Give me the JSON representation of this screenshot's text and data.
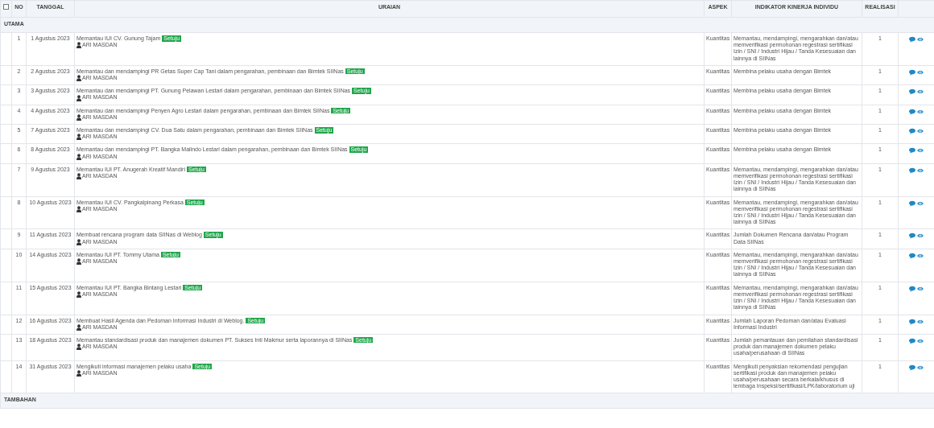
{
  "table": {
    "select_all": {
      "checked": false
    },
    "columns": [
      "NO",
      "TANGGAL",
      "URAIAN",
      "ASPEK",
      "INDIKATOR KINERJA INDIVIDU",
      "REALISASI"
    ],
    "sections": [
      {
        "title": "UTAMA",
        "rows": [
          {
            "no": "1",
            "date": "1 Agustus 2023",
            "uraian": "Memantau IUI CV. Gunung Tajam",
            "status": "Setuju",
            "person": "ARI MASDAN",
            "aspek": "Kuantitas",
            "indikator": "Memantau, mendampingi, mengarahkan dan/atau memverifikasi permohonan regestrasi sertifikasi Izin / SNI / Industri Hijau / Tanda Kesesuaian dan lainnya di SIINas",
            "realisasi": "1"
          },
          {
            "no": "2",
            "date": "2 Agustus 2023",
            "uraian": "Memantau dan mendampingi PR Getas Super Cap Tani dalam pengarahan, pembinaan dan Bimtek SIINas",
            "status": "Setuju",
            "person": "ARI MASDAN",
            "aspek": "Kuantitas",
            "indikator": "Membina pelaku usaha dengan Bimtek",
            "realisasi": "1"
          },
          {
            "no": "3",
            "date": "3 Agustus 2023",
            "uraian": "Memantau dan mendampingi PT. Gunung Pelawan Lestari dalam pengarahan, pembinaan dan Bimtek SIINas",
            "status": "Setuju",
            "person": "ARI MASDAN",
            "aspek": "Kuantitas",
            "indikator": "Membina pelaku usaha dengan Bimtek",
            "realisasi": "1"
          },
          {
            "no": "4",
            "date": "4 Agustus 2023",
            "uraian": "Memantau dan mendampingi Penyen Agro Lestari dalam pengarahan, pembinaan dan Bimtek SIINas",
            "status": "Setuju",
            "person": "ARI MASDAN",
            "aspek": "Kuantitas",
            "indikator": "Membina pelaku usaha dengan Bimtek",
            "realisasi": "1"
          },
          {
            "no": "5",
            "date": "7 Agustus 2023",
            "uraian": "Memantau dan mendampingi CV. Dua Satu dalam pengarahan, pembinaan dan Bimtek SIINas",
            "status": "Setuju",
            "person": "ARI MASDAN",
            "aspek": "Kuantitas",
            "indikator": "Membina pelaku usaha dengan Bimtek",
            "realisasi": "1"
          },
          {
            "no": "6",
            "date": "8 Agustus 2023",
            "uraian": "Memantau dan mendampingi PT. Bangka Malindo Lestari dalam pengarahan, pembinaan dan Bimtek SIINas",
            "status": "Setuju",
            "person": "ARI MASDAN",
            "aspek": "Kuantitas",
            "indikator": "Membina pelaku usaha dengan Bimtek",
            "realisasi": "1"
          },
          {
            "no": "7",
            "date": "9 Agustus 2023",
            "uraian": "Memantau IUI PT. Anugerah Kreatif Mandiri",
            "status": "Setuju",
            "person": "ARI MASDAN",
            "aspek": "Kuantitas",
            "indikator": "Memantau, mendampingi, mengarahkan dan/atau memverifikasi permohonan regestrasi sertifikasi Izin / SNI / Industri Hijau / Tanda Kesesuaian dan lainnya di SIINas",
            "realisasi": "1"
          },
          {
            "no": "8",
            "date": "10 Agustus 2023",
            "uraian": "Memantau IUI CV. Pangkalpinang Perkasa",
            "status": "Setuju",
            "person": "ARI MASDAN",
            "aspek": "Kuantitas",
            "indikator": "Memantau, mendampingi, mengarahkan dan/atau memverifikasi permohonan regestrasi sertifikasi Izin / SNI / Industri Hijau / Tanda Kesesuaian dan lainnya di SIINas",
            "realisasi": "1"
          },
          {
            "no": "9",
            "date": "11 Agustus 2023",
            "uraian": "Membuat rencana program data SIINas di Weblog",
            "status": "Setuju",
            "person": "ARI MASDAN",
            "aspek": "Kuantitas",
            "indikator": "Jumlah Dokumen Rencana dan/atau Program Data SIINas",
            "realisasi": "1"
          },
          {
            "no": "10",
            "date": "14 Agustus 2023",
            "uraian": "Memantau IUI PT. Tommy Utama",
            "status": "Setuju",
            "person": "ARI MASDAN",
            "aspek": "Kuantitas",
            "indikator": "Memantau, mendampingi, mengarahkan dan/atau memverifikasi permohonan regestrasi sertifikasi Izin / SNI / Industri Hijau / Tanda Kesesuaian dan lainnya di SIINas",
            "realisasi": "1"
          },
          {
            "no": "11",
            "date": "15 Agustus 2023",
            "uraian": "Memantau IUI PT. Bangka Bintang Lestari",
            "status": "Setuju",
            "person": "ARI MASDAN",
            "aspek": "Kuantitas",
            "indikator": "Memantau, mendampingi, mengarahkan dan/atau memverifikasi permohonan regestrasi sertifikasi Izin / SNI / Industri Hijau / Tanda Kesesuaian dan lainnya di SIINas",
            "realisasi": "1"
          },
          {
            "no": "12",
            "date": "16 Agustus 2023",
            "uraian": "Membuat Hasil Agenda dan Pedoman Informasi Industri di Weblog.",
            "status": "Setuju",
            "person": "ARI MASDAN",
            "aspek": "Kuantitas",
            "indikator": "Jumlah Laporan Pedoman dan/atau Evaluasi Informasi Industri",
            "realisasi": "1"
          },
          {
            "no": "13",
            "date": "18 Agustus 2023",
            "uraian": "Memantau standardisasi produk dan manajemen dokumen PT. Sukses Inti Makmur serta laporannya di SIINas",
            "status": "Setuju",
            "person": "ARI MASDAN",
            "aspek": "Kuantitas",
            "indikator": "Jumlah pemantauan dan pemilahan standardisasi produk dan manajemen dokumen pelaku usaha/perusahaan di SIINas",
            "realisasi": "1"
          },
          {
            "no": "14",
            "date": "31 Agustus 2023",
            "uraian": "Mengikuti informasi manajemen pelaku usaha",
            "status": "Setuju",
            "person": "ARI MASDAN",
            "aspek": "Kuantitas",
            "indikator": "Mengikuti penyaksian rekomendasi pengujian sertifikasi produk dan manajemen pelaku usaha/perusahaan secara berkala/khusus di lembaga Inspeksi/sertifikasi/LPK/laboratorium uji",
            "realisasi": "1"
          }
        ]
      },
      {
        "title": "TAMBAHAN"
      }
    ]
  }
}
